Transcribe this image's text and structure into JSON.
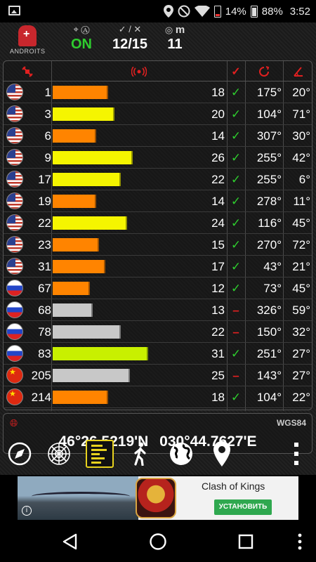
{
  "status_bar": {
    "battery_left_pct": "14%",
    "battery_right_pct": "88%",
    "time": "3:52",
    "icons": [
      "image-icon",
      "location-icon",
      "do-not-disturb-icon",
      "wifi-icon",
      "battery-icon",
      "battery-icon"
    ]
  },
  "app": {
    "logo_text": "ANDROITS",
    "gps_status": "ON",
    "satellites": "12/15",
    "accuracy": "11",
    "accuracy_unit": "m"
  },
  "colors": {
    "header_icon": "#e02020",
    "used_yes": "#2ecc2e",
    "bar_orange": "#ff8400",
    "bar_yellow": "#f5f500",
    "bar_lime": "#c8f000",
    "bar_gray": "#c8c8c8",
    "accent_yellow": "#e8d21e"
  },
  "table": {
    "columns": [
      "satellite-icon",
      "signal-icon",
      "checkmark-icon",
      "azimuth-icon",
      "elevation-icon"
    ],
    "rows": [
      {
        "flag": "us",
        "prn": "1",
        "snr": "18",
        "used": "✓",
        "az": "175°",
        "el": "20°",
        "bar_color": "orange"
      },
      {
        "flag": "us",
        "prn": "3",
        "snr": "20",
        "used": "✓",
        "az": "104°",
        "el": "71°",
        "bar_color": "yellow"
      },
      {
        "flag": "us",
        "prn": "6",
        "snr": "14",
        "used": "✓",
        "az": "307°",
        "el": "30°",
        "bar_color": "orange"
      },
      {
        "flag": "us",
        "prn": "9",
        "snr": "26",
        "used": "✓",
        "az": "255°",
        "el": "42°",
        "bar_color": "yellow"
      },
      {
        "flag": "us",
        "prn": "17",
        "snr": "22",
        "used": "✓",
        "az": "255°",
        "el": "6°",
        "bar_color": "yellow"
      },
      {
        "flag": "us",
        "prn": "19",
        "snr": "14",
        "used": "✓",
        "az": "278°",
        "el": "11°",
        "bar_color": "orange"
      },
      {
        "flag": "us",
        "prn": "22",
        "snr": "24",
        "used": "✓",
        "az": "116°",
        "el": "45°",
        "bar_color": "yellow"
      },
      {
        "flag": "us",
        "prn": "23",
        "snr": "15",
        "used": "✓",
        "az": "270°",
        "el": "72°",
        "bar_color": "orange"
      },
      {
        "flag": "us",
        "prn": "31",
        "snr": "17",
        "used": "✓",
        "az": "43°",
        "el": "21°",
        "bar_color": "orange"
      },
      {
        "flag": "ru",
        "prn": "67",
        "snr": "12",
        "used": "✓",
        "az": "73°",
        "el": "45°",
        "bar_color": "orange"
      },
      {
        "flag": "ru",
        "prn": "68",
        "snr": "13",
        "used": "–",
        "az": "326°",
        "el": "59°",
        "bar_color": "gray"
      },
      {
        "flag": "ru",
        "prn": "78",
        "snr": "22",
        "used": "–",
        "az": "150°",
        "el": "32°",
        "bar_color": "gray"
      },
      {
        "flag": "ru",
        "prn": "83",
        "snr": "31",
        "used": "✓",
        "az": "251°",
        "el": "27°",
        "bar_color": "lime"
      },
      {
        "flag": "cn",
        "prn": "205",
        "snr": "25",
        "used": "–",
        "az": "143°",
        "el": "27°",
        "bar_color": "gray"
      },
      {
        "flag": "cn",
        "prn": "214",
        "snr": "18",
        "used": "✓",
        "az": "104°",
        "el": "22°",
        "bar_color": "orange"
      }
    ]
  },
  "position": {
    "datum": "WGS84",
    "latitude": "46°26.5219'N",
    "longitude": "030°44.7627'E"
  },
  "toolbar": {
    "items": [
      "compass-icon",
      "sky-radar-icon",
      "signal-bars-icon",
      "walking-icon",
      "globe-icon",
      "map-pin-icon",
      "more-vert-icon"
    ],
    "active": "signal-bars-icon"
  },
  "ad": {
    "title": "Clash of Kings",
    "install_label": "УСТАНОВИТЬ",
    "info": "i"
  },
  "nav": {
    "items": [
      "back-icon",
      "home-icon",
      "recents-icon",
      "more-vert-icon"
    ]
  }
}
